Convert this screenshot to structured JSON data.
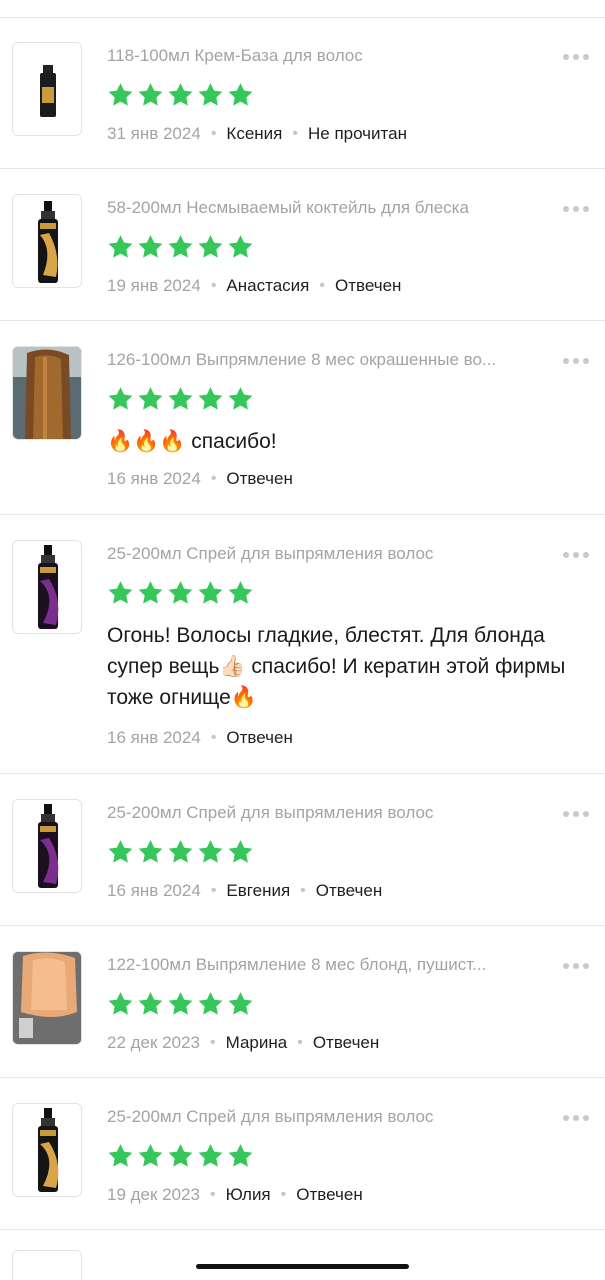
{
  "colors": {
    "star": "#35c759",
    "muted": "#a3a3a8",
    "text": "#1f1f1f"
  },
  "reviews": [
    {
      "title": "118-100мл Крем-База для волос",
      "rating": 5,
      "date": "31 янв 2024",
      "author": "Ксения",
      "status": "Не прочитан",
      "text": "",
      "thumb": "bottle-small"
    },
    {
      "title": "58-200мл Несмываемый коктейль для блеска",
      "rating": 5,
      "date": "19 янв 2024",
      "author": "Анастасия",
      "status": "Отвечен",
      "text": "",
      "thumb": "bottle-gold"
    },
    {
      "title": "126-100мл Выпрямление 8 мес окрашенные во...",
      "rating": 5,
      "date": "16 янв 2024",
      "author": "",
      "status": "Отвечен",
      "text": "🔥🔥🔥 спасибо!",
      "thumb": "photo-hair-brown"
    },
    {
      "title": "25-200мл Спрей для выпрямления волос",
      "rating": 5,
      "date": "16 янв 2024",
      "author": "",
      "status": "Отвечен",
      "text": "Огонь! Волосы гладкие, блестят. Для блонда супер вещь👍🏻 спасибо! И кератин этой фирмы тоже огнище🔥",
      "thumb": "bottle-purple"
    },
    {
      "title": "25-200мл Спрей для выпрямления волос",
      "rating": 5,
      "date": "16 янв 2024",
      "author": "Евгения",
      "status": "Отвечен",
      "text": "",
      "thumb": "bottle-purple"
    },
    {
      "title": "122-100мл Выпрямление 8 мес блонд, пушист...",
      "rating": 5,
      "date": "22 дек 2023",
      "author": "Марина",
      "status": "Отвечен",
      "text": "",
      "thumb": "photo-hair-blond"
    },
    {
      "title": "25-200мл Спрей для выпрямления волос",
      "rating": 5,
      "date": "19 дек 2023",
      "author": "Юлия",
      "status": "Отвечен",
      "text": "",
      "thumb": "bottle-purple"
    }
  ]
}
